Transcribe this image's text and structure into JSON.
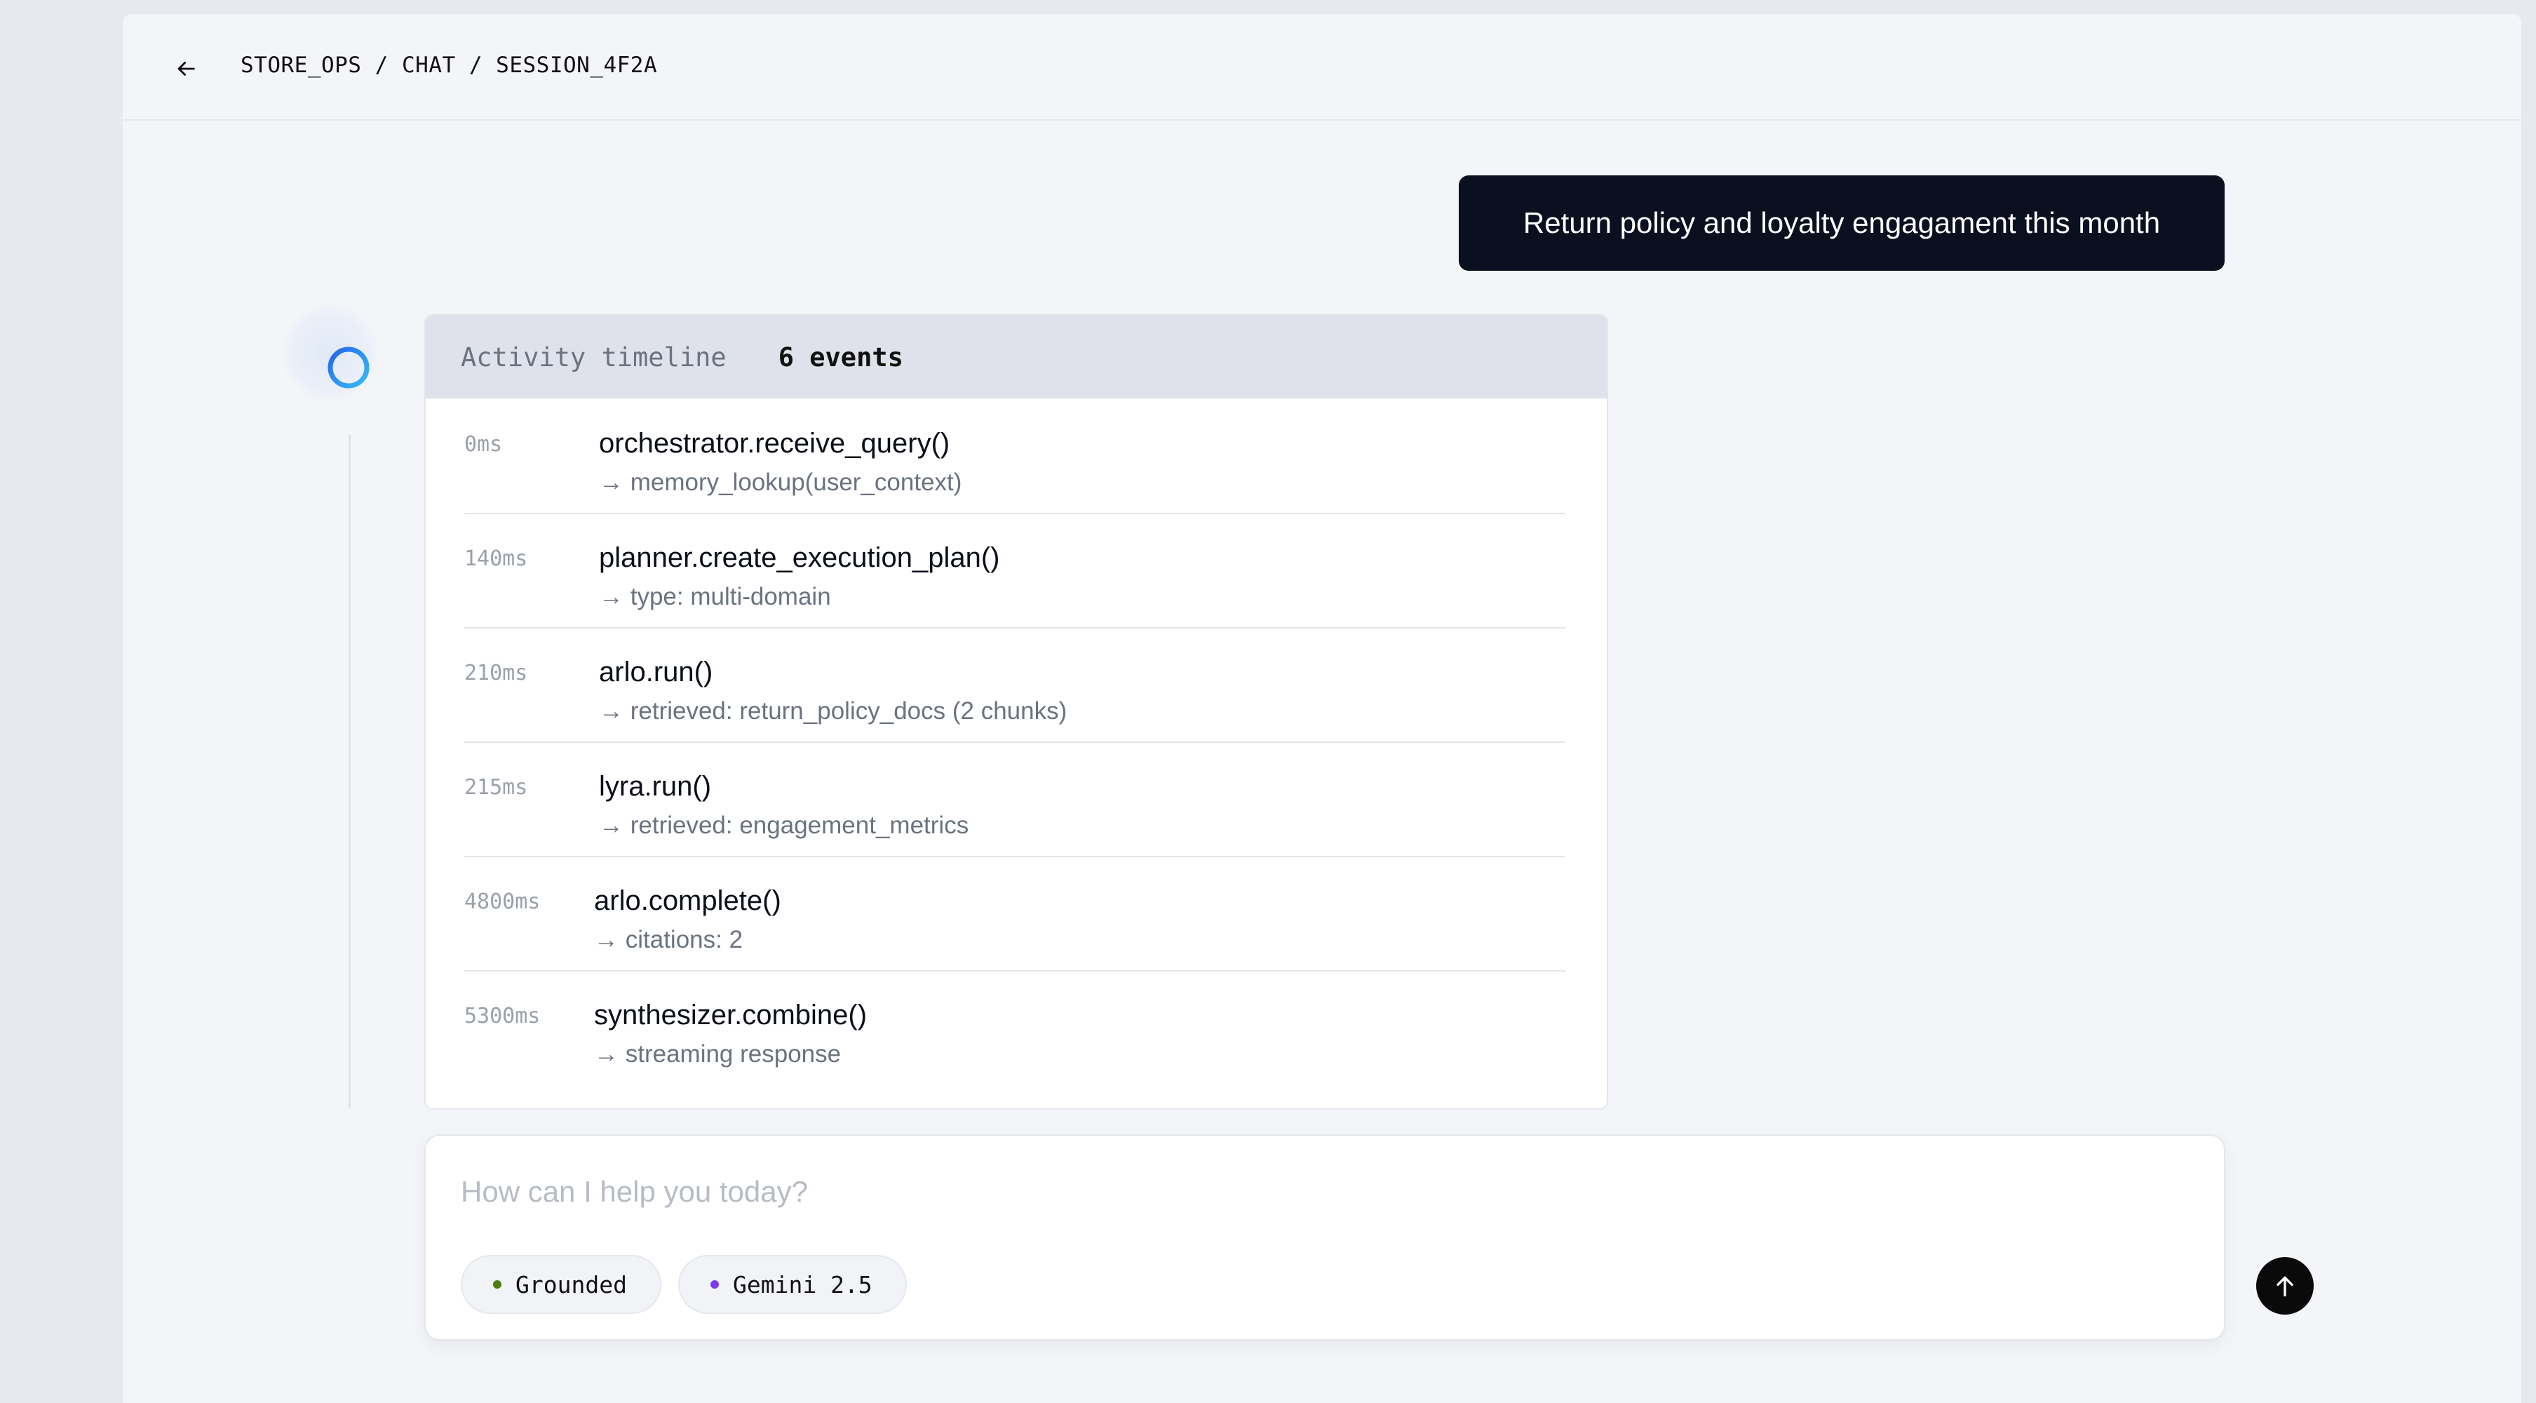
{
  "breadcrumb": {
    "items": [
      "STORE_OPS",
      "CHAT",
      "SESSION_4F2A"
    ],
    "separator": "/"
  },
  "user_message": {
    "text": "Return policy and loyalty engagament this month"
  },
  "timeline": {
    "title": "Activity timeline",
    "count_label": "6 events",
    "events": [
      {
        "time": "0ms",
        "fn": "orchestrator.receive_query()",
        "detail": "→ memory_lookup(user_context)"
      },
      {
        "time": "140ms",
        "fn": "planner.create_execution_plan()",
        "detail": "→ type: multi-domain"
      },
      {
        "time": "210ms",
        "fn": "arlo.run()",
        "detail": "→ retrieved: return_policy_docs (2 chunks)"
      },
      {
        "time": "215ms",
        "fn": "lyra.run()",
        "detail": "→ retrieved: engagement_metrics"
      },
      {
        "time": "4800ms",
        "fn": "arlo.complete()",
        "detail": "→ citations: 2"
      },
      {
        "time": "5300ms",
        "fn": "synthesizer.combine()",
        "detail": "→ streaming response"
      }
    ]
  },
  "composer": {
    "placeholder": "How can I help you today?",
    "value": "",
    "chips": {
      "grounded": {
        "label": "Grounded",
        "dot_color": "#4d7c0f"
      },
      "model": {
        "label": "Gemini 2.5",
        "dot_color": "#7c3aed"
      }
    }
  },
  "icons": {
    "back": "arrow-left-icon",
    "agent": "loading-ring-icon",
    "send": "arrow-up-icon"
  },
  "colors": {
    "user_bubble": "#0b1020",
    "agent_ring": "#3b82f6",
    "send_button": "#0a0a0a"
  }
}
